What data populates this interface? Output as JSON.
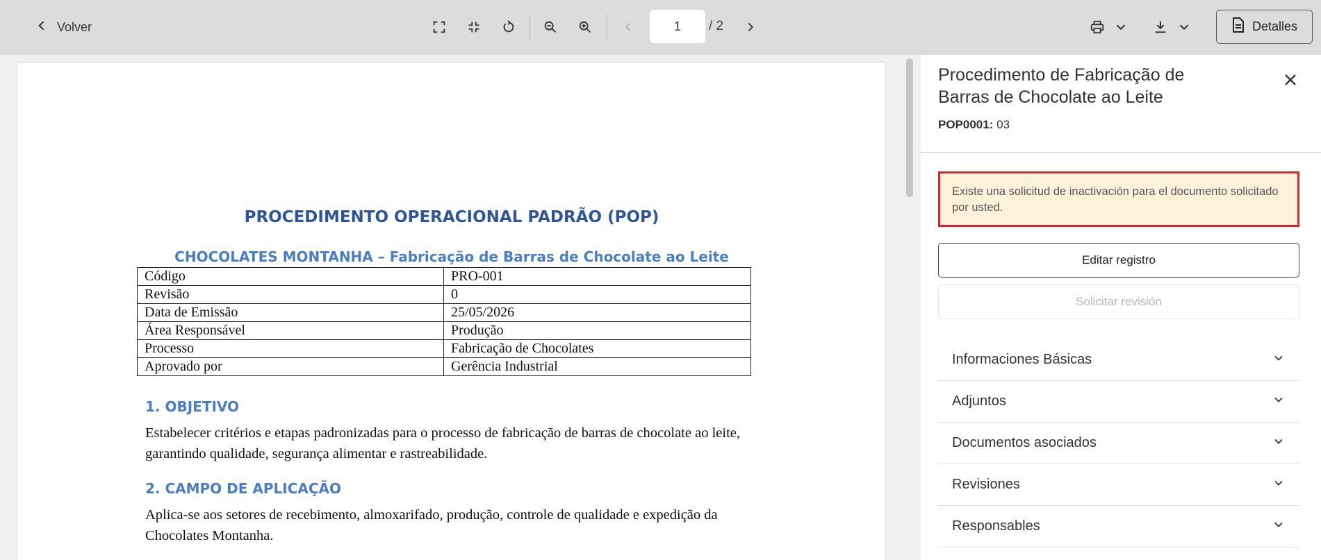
{
  "toolbar": {
    "back_label": "Volver",
    "tools": [
      "fullscreen-icon",
      "exit-fullscreen-icon",
      "rotate-icon",
      "zoom-out-icon",
      "zoom-in-icon"
    ],
    "current_page": "1",
    "total_pages": "/ 2",
    "details_label": "Detalles"
  },
  "document": {
    "title": "PROCEDIMENTO OPERACIONAL PADRÃO (POP)",
    "subtitle": "CHOCOLATES MONTANHA – Fabricação de Barras de Chocolate ao Leite",
    "table": [
      {
        "key": "Código",
        "value": "PRO-001"
      },
      {
        "key": "Revisão",
        "value": "0"
      },
      {
        "key": "Data de Emissão",
        "value": "25/05/2026"
      },
      {
        "key": "Área Responsável",
        "value": "Produção"
      },
      {
        "key": "Processo",
        "value": "Fabricação de Chocolates"
      },
      {
        "key": "Aprovado por",
        "value": "Gerência Industrial"
      }
    ],
    "sections": [
      {
        "heading": "1. OBJETIVO",
        "text": "Estabelecer critérios e etapas padronizadas para o processo de fabricação de barras de chocolate ao leite, garantindo qualidade, segurança alimentar e rastreabilidade."
      },
      {
        "heading": "2. CAMPO DE APLICAÇÃO",
        "text": "Aplica-se aos setores de recebimento, almoxarifado, produção, controle de qualidade e expedição da Chocolates Montanha."
      }
    ]
  },
  "panel": {
    "title": "Procedimento de Fabricação de Barras de Chocolate ao Leite",
    "code_label": "POP0001:",
    "code_value": "03",
    "alert": "Existe una solicitud de inactivación para el documento solicitado por usted.",
    "edit_button": "Editar registro",
    "review_button": "Solicitar revisión",
    "accordion": [
      "Informaciones Básicas",
      "Adjuntos",
      "Documentos asociados",
      "Revisiones",
      "Responsables"
    ]
  },
  "colors": {
    "doc_title": "#2f5597",
    "doc_heading": "#4a7ec1",
    "alert_border": "#d6262e",
    "alert_bg": "#fdf1da",
    "toolbar_bg": "#dcdcdc"
  }
}
